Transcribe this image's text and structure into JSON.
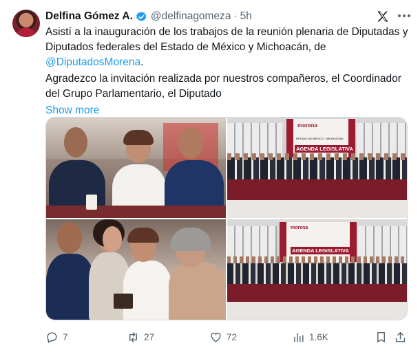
{
  "author": {
    "name": "Delfina Gómez A.",
    "handle": "@delfinagomeza",
    "separator": "·",
    "time": "5h"
  },
  "tweet": {
    "line1": "Asistí a la inauguración de los trabajos de la reunión plenaria de Diputadas y Diputados federales del Estado de México y Michoacán, de",
    "mention": "@DiputadosMorena",
    "mention_suffix": ".",
    "line2": "Agradezco la invitación realizada por nuestros compañeros, el Coordinador del Grupo Parlamentario, el Diputado",
    "show_more": "Show more"
  },
  "media": {
    "banner_top_text": "morena",
    "banner_title": "AGENDA LEGISLATIVA",
    "banner_small": "ESTADO DE MÉXICO - MICHOACÁN"
  },
  "actions": {
    "replies": "7",
    "reposts": "27",
    "likes": "72",
    "views": "1.6K"
  },
  "icons": [
    "verified-badge-icon",
    "x-logo-icon",
    "more-icon",
    "reply-icon",
    "repost-icon",
    "like-icon",
    "views-icon",
    "bookmark-icon",
    "share-icon"
  ],
  "colors": {
    "accent": "#1d9bf0",
    "muted": "#536471",
    "text": "#0f1419",
    "morena": "#9b1b30"
  }
}
